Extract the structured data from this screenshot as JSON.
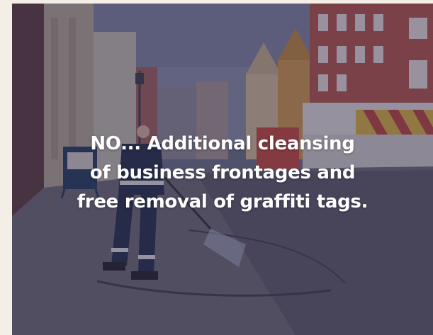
{
  "hero": {
    "headline_lines": [
      "NO... Additional cleansing",
      "of business frontages and",
      "free removal of graffiti tags."
    ]
  },
  "colors": {
    "page_background": "#f3efe7",
    "overlay": "#302c4e",
    "headline_text": "#ffffff"
  },
  "icons": {
    "photo": "street-cleaning-photo"
  }
}
